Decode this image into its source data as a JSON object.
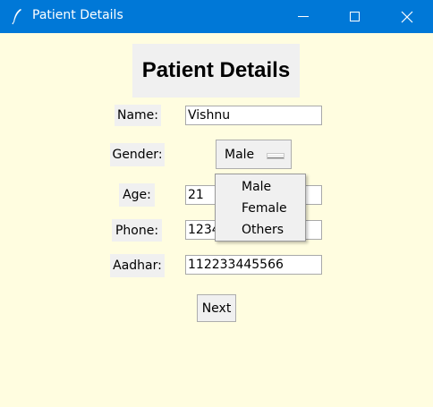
{
  "window": {
    "title": "Patient Details",
    "icon": "feather-icon",
    "titlebar_color": "#0078d7"
  },
  "form": {
    "heading": "Patient Details",
    "background": "#fffde0",
    "name": {
      "label": "Name:",
      "value": "Vishnu"
    },
    "gender": {
      "label": "Gender:",
      "selected": "Male",
      "options": [
        "Male",
        "Female",
        "Others"
      ]
    },
    "age": {
      "label": "Age:",
      "value": "21"
    },
    "phone": {
      "label": "Phone:",
      "value": "1234"
    },
    "aadhar": {
      "label": "Aadhar:",
      "value": "112233445566"
    },
    "next_label": "Next"
  }
}
